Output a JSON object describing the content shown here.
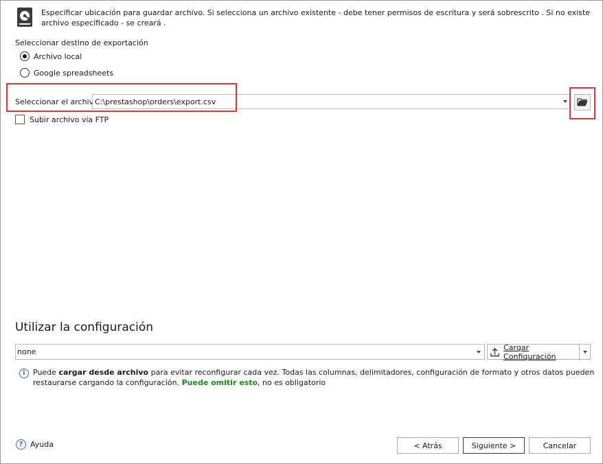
{
  "header": {
    "description": "Especificar ubicación para guardar archivo. Si selecciona un archivo existente - debe tener permisos de escritura y será sobrescrito . Si no existe archivo especificado - se creará ."
  },
  "destination": {
    "title": "Seleccionar destino de exportación",
    "options": [
      {
        "label": "Archivo local",
        "selected": true
      },
      {
        "label": "Google spreadsheets",
        "selected": false
      }
    ]
  },
  "file": {
    "label": "Seleccionar el archivo",
    "value": "C:\\prestashop\\orders\\export.csv",
    "ftp_label": "Subir archivo vía FTP",
    "ftp_checked": false
  },
  "config": {
    "title": "Utilizar la configuración",
    "selected": "none",
    "load_label": "Cargar Configuración",
    "info": {
      "part1": "Puede ",
      "bold": "cargar desde archivo",
      "part2": " para evitar reconfigurar cada vez. Todas las columnas, delimitadores, configuración de formato y otros datos pueden restaurarse cargando la configuración. ",
      "green": "Puede omitir esto",
      "part3": ", no es obligatorio"
    }
  },
  "footer": {
    "help_label": "Ayuda",
    "back_label": "< Atrás",
    "next_label": "Siguiente >",
    "cancel_label": "Cancelar"
  },
  "colors": {
    "highlight": "#e03434",
    "accent_green": "#1b8a1b",
    "info_blue": "#2b6cb8"
  }
}
